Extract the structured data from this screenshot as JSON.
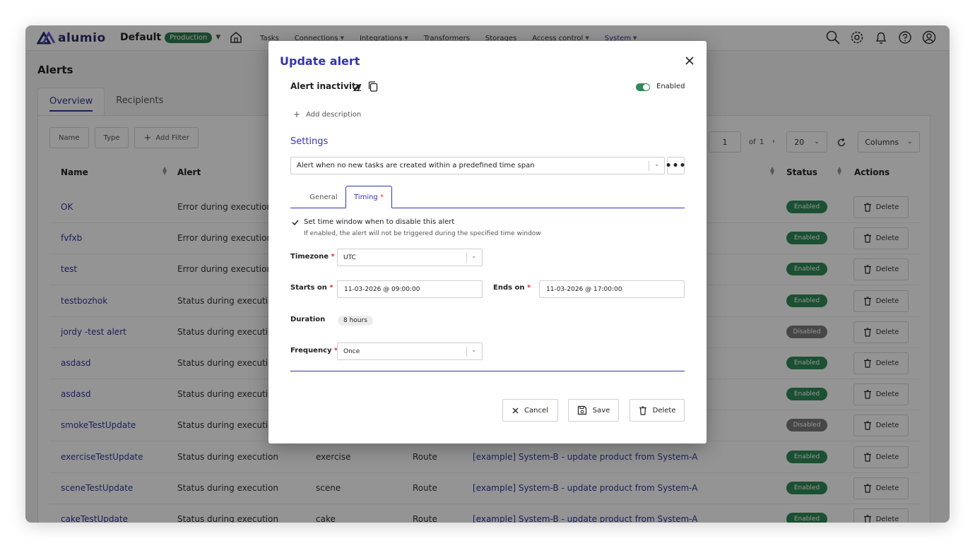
{
  "nav": {
    "logo_text": "alumio",
    "environment": "Default",
    "environment_badge": "Production",
    "items": [
      {
        "label": "Tasks"
      },
      {
        "label": "Connections"
      },
      {
        "label": "Integrations"
      },
      {
        "label": "Transformers"
      },
      {
        "label": "Storages"
      },
      {
        "label": "Access control"
      },
      {
        "label": "System"
      }
    ]
  },
  "page": {
    "title": "Alerts",
    "tabs": [
      "Overview",
      "Recipients"
    ],
    "filters": [
      "Name",
      "Type",
      "Add Filter"
    ],
    "pager": {
      "page": "1",
      "of_label": "of",
      "total": "1",
      "per_page": "20",
      "columns_label": "Columns"
    },
    "headers": {
      "name": "Name",
      "alert": "Alert",
      "status": "Status",
      "actions": "Actions"
    },
    "delete_label": "Delete",
    "rows": [
      {
        "name": "OK",
        "alert": "Error during execution",
        "c3": "",
        "c4": "",
        "c5": "",
        "status": "Enabled"
      },
      {
        "name": "fvfxb",
        "alert": "Error during execution",
        "c3": "",
        "c4": "",
        "c5": "",
        "status": "Enabled"
      },
      {
        "name": "test",
        "alert": "Error during execution",
        "c3": "",
        "c4": "",
        "c5": "",
        "status": "Enabled"
      },
      {
        "name": "testbozhok",
        "alert": "Status during execution",
        "c3": "",
        "c4": "",
        "c5": "",
        "status": "Enabled"
      },
      {
        "name": "jordy -test alert",
        "alert": "Status during execution",
        "c3": "",
        "c4": "",
        "c5": "",
        "status": "Disabled"
      },
      {
        "name": "asdasd",
        "alert": "Status during execution",
        "c3": "",
        "c4": "",
        "c5": "",
        "status": "Enabled"
      },
      {
        "name": "asdasd",
        "alert": "Status during execution",
        "c3": "",
        "c4": "",
        "c5": "",
        "status": "Enabled"
      },
      {
        "name": "smokeTestUpdate",
        "alert": "Status during execution",
        "c3": "",
        "c4": "",
        "c5": "",
        "status": "Disabled"
      },
      {
        "name": "exerciseTestUpdate",
        "alert": "Status during execution",
        "c3": "exercise",
        "c4": "Route",
        "c5": "[example] System-B - update product from System-A",
        "status": "Enabled"
      },
      {
        "name": "sceneTestUpdate",
        "alert": "Status during execution",
        "c3": "scene",
        "c4": "Route",
        "c5": "[example] System-B - update product from System-A",
        "status": "Enabled"
      },
      {
        "name": "cakeTestUpdate",
        "alert": "Status during execution",
        "c3": "cake",
        "c4": "Route",
        "c5": "[example] System-B - update product from System-A",
        "status": "Enabled"
      }
    ]
  },
  "modal": {
    "title": "Update alert",
    "alert_name": "Alert inactivity",
    "enabled_label": "Enabled",
    "add_description": "Add description",
    "settings_title": "Settings",
    "alert_type": "Alert when no new tasks are created within a predefined time span",
    "tabs": {
      "general": "General",
      "timing": "Timing",
      "required_mark": "*"
    },
    "timing": {
      "checkbox_label": "Set time window when to disable this alert",
      "checkbox_help": "If enabled, the alert will not be triggered during the specified time window",
      "timezone_label": "Timezone",
      "timezone_value": "UTC",
      "starts_label": "Starts on",
      "starts_value": "11-03-2026 @ 09:00:00",
      "ends_label": "Ends on",
      "ends_value": "11-03-2026 @ 17:00:00",
      "duration_label": "Duration",
      "duration_value": "8 hours",
      "frequency_label": "Frequency",
      "frequency_value": "Once"
    },
    "buttons": {
      "cancel": "Cancel",
      "save": "Save",
      "delete": "Delete"
    }
  },
  "colors": {
    "brand": "#3434b0",
    "enabled": "#2f8a57",
    "disabled": "#7a7a7a"
  }
}
